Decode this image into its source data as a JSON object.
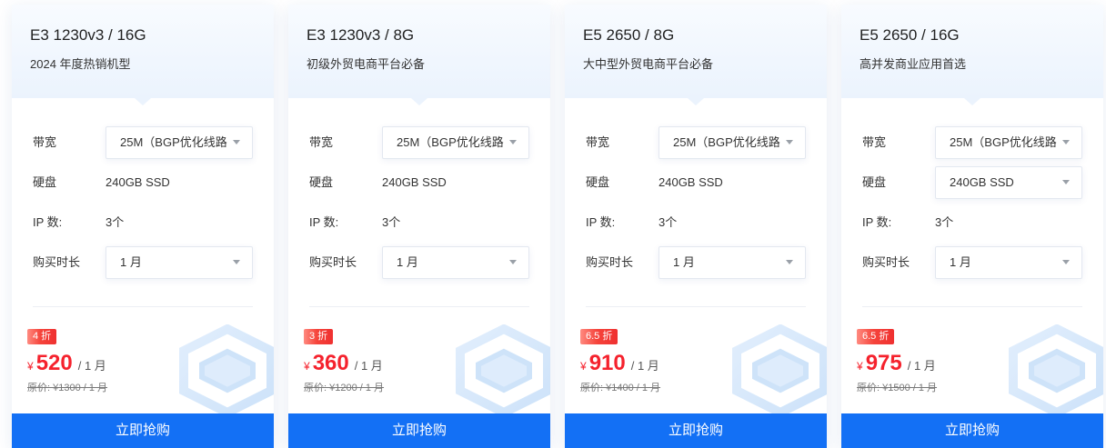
{
  "cards": [
    {
      "title": "E3 1230v3 / 16G",
      "subtitle": "2024 年度热销机型",
      "bandwidth": {
        "label": "带宽",
        "value": "25M（BGP优化线路"
      },
      "disk": {
        "label": "硬盘",
        "value": "240GB SSD",
        "dropdown": false
      },
      "ip": {
        "label": "IP 数:",
        "value": "3个"
      },
      "duration": {
        "label": "购买时长",
        "value": "1 月"
      },
      "discount": "4 折",
      "currency": "¥",
      "price": "520",
      "period": "/ 1 月",
      "original_price": "原价: ¥1300 / 1 月",
      "buy_button": "立即抢购"
    },
    {
      "title": "E3 1230v3 / 8G",
      "subtitle": "初级外贸电商平台必备",
      "bandwidth": {
        "label": "带宽",
        "value": "25M（BGP优化线路"
      },
      "disk": {
        "label": "硬盘",
        "value": "240GB SSD",
        "dropdown": false
      },
      "ip": {
        "label": "IP 数:",
        "value": "3个"
      },
      "duration": {
        "label": "购买时长",
        "value": "1 月"
      },
      "discount": "3 折",
      "currency": "¥",
      "price": "360",
      "period": "/ 1 月",
      "original_price": "原价: ¥1200 / 1 月",
      "buy_button": "立即抢购"
    },
    {
      "title": "E5 2650 / 8G",
      "subtitle": "大中型外贸电商平台必备",
      "bandwidth": {
        "label": "带宽",
        "value": "25M（BGP优化线路"
      },
      "disk": {
        "label": "硬盘",
        "value": "240GB SSD",
        "dropdown": false
      },
      "ip": {
        "label": "IP 数:",
        "value": "3个"
      },
      "duration": {
        "label": "购买时长",
        "value": "1 月"
      },
      "discount": "6.5 折",
      "currency": "¥",
      "price": "910",
      "period": "/ 1 月",
      "original_price": "原价: ¥1400 / 1 月",
      "buy_button": "立即抢购"
    },
    {
      "title": "E5 2650 / 16G",
      "subtitle": "高并发商业应用首选",
      "bandwidth": {
        "label": "带宽",
        "value": "25M（BGP优化线路"
      },
      "disk": {
        "label": "硬盘",
        "value": "240GB SSD",
        "dropdown": true
      },
      "ip": {
        "label": "IP 数:",
        "value": "3个"
      },
      "duration": {
        "label": "购买时长",
        "value": "1 月"
      },
      "discount": "6.5 折",
      "currency": "¥",
      "price": "975",
      "period": "/ 1 月",
      "original_price": "原价: ¥1500 / 1 月",
      "buy_button": "立即抢购"
    }
  ],
  "icons": {
    "select_caret": "chevron-down-icon",
    "card_decoration": "hexagon-cube-icon"
  },
  "colors": {
    "accent": "#1370f5",
    "price": "#f5222d",
    "badge": "#f5443b",
    "header_bg": "#ebf3fd",
    "decoration": "#d3e6fb"
  }
}
